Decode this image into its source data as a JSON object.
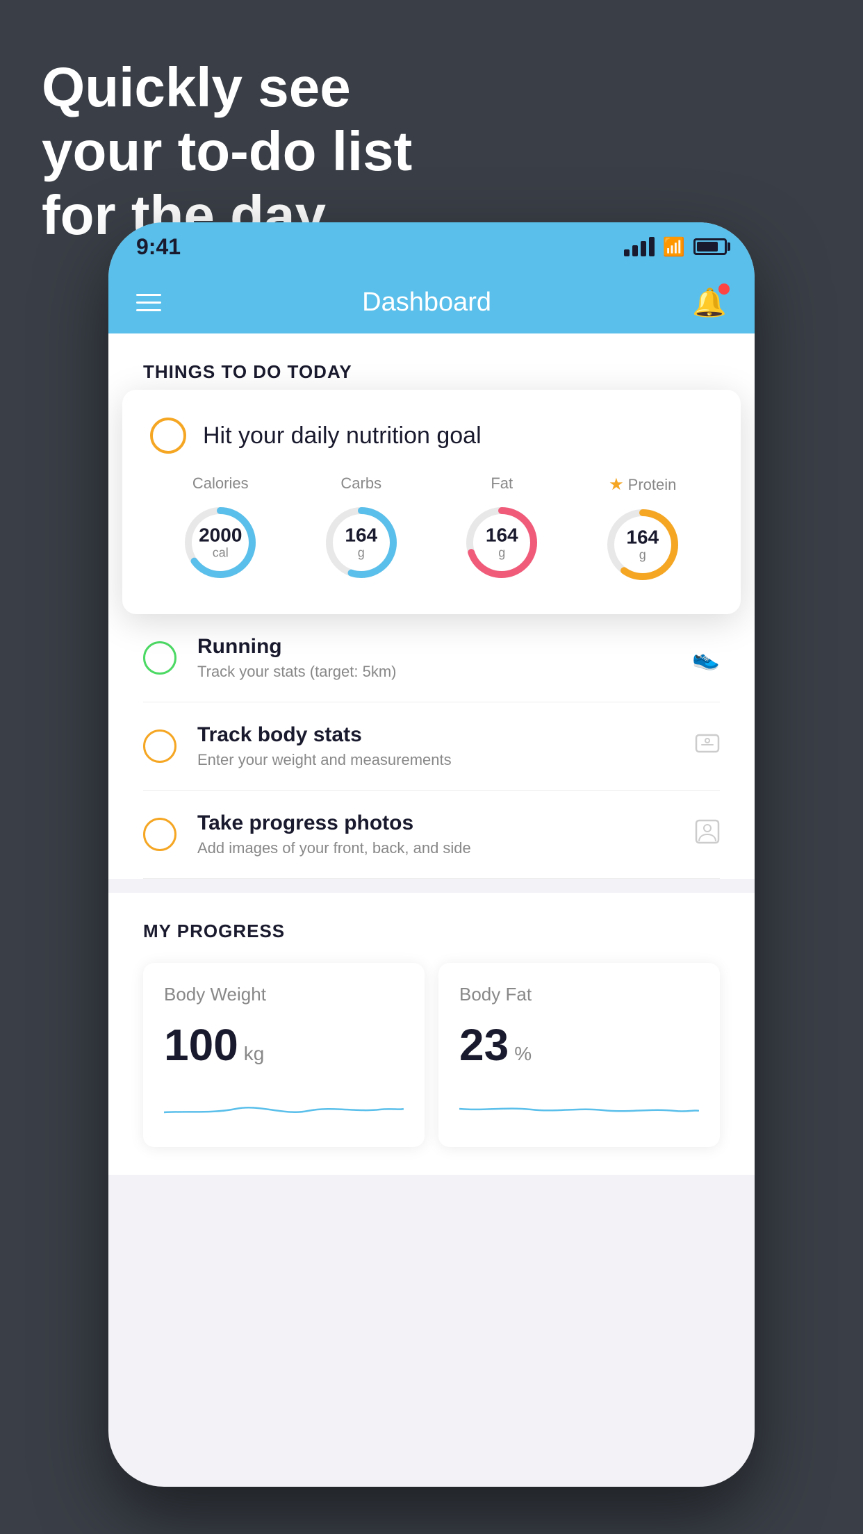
{
  "headline": {
    "line1": "Quickly see",
    "line2": "your to-do list",
    "line3": "for the day."
  },
  "status_bar": {
    "time": "9:41"
  },
  "header": {
    "title": "Dashboard"
  },
  "things_today": {
    "section_title": "THINGS TO DO TODAY"
  },
  "nutrition_card": {
    "title": "Hit your daily nutrition goal",
    "macros": [
      {
        "label": "Calories",
        "value": "2000",
        "unit": "cal",
        "color": "#5abfea",
        "percent": 65
      },
      {
        "label": "Carbs",
        "value": "164",
        "unit": "g",
        "color": "#5abfea",
        "percent": 55
      },
      {
        "label": "Fat",
        "value": "164",
        "unit": "g",
        "color": "#f05b7a",
        "percent": 70
      },
      {
        "label": "Protein",
        "value": "164",
        "unit": "g",
        "color": "#f5a623",
        "percent": 60,
        "starred": true
      }
    ]
  },
  "todo_items": [
    {
      "name": "Running",
      "sub": "Track your stats (target: 5km)",
      "circle_color": "green",
      "icon": "👟"
    },
    {
      "name": "Track body stats",
      "sub": "Enter your weight and measurements",
      "circle_color": "yellow",
      "icon": "⚖️"
    },
    {
      "name": "Take progress photos",
      "sub": "Add images of your front, back, and side",
      "circle_color": "yellow",
      "icon": "👤"
    }
  ],
  "progress": {
    "section_title": "MY PROGRESS",
    "cards": [
      {
        "title": "Body Weight",
        "value": "100",
        "unit": "kg"
      },
      {
        "title": "Body Fat",
        "value": "23",
        "unit": "%"
      }
    ]
  }
}
